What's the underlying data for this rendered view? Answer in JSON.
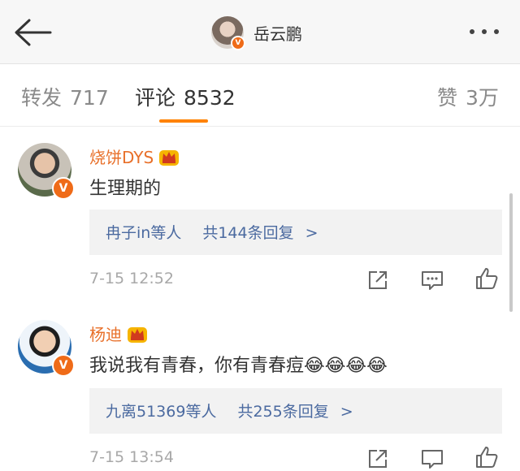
{
  "header": {
    "title": "岳云鹏",
    "verified_badge": "V"
  },
  "tabs": [
    {
      "label": "转发",
      "count": "717",
      "active": false
    },
    {
      "label": "评论",
      "count": "8532",
      "active": true
    },
    {
      "label": "赞",
      "count": "3万",
      "active": false
    }
  ],
  "comments": [
    {
      "user": "烧饼DYS",
      "verified_badge": "V",
      "text": "生理期的",
      "replies_by": "冉子in等人",
      "replies_count": "共144条回复",
      "chevron": ">",
      "time": "7-15 12:52"
    },
    {
      "user": "杨迪",
      "verified_badge": "V",
      "text": "我说我有青春，你有青春痘",
      "emoji": "😂😂😂😂",
      "replies_by": "九离51369等人",
      "replies_count": "共255条回复",
      "chevron": ">",
      "time": "7-15 13:54"
    }
  ],
  "colors": {
    "accent": "#ff8200",
    "username": "#e8702a",
    "link": "#4b6aa0",
    "verified": "#ef6b18"
  },
  "icons": [
    "back-arrow-icon",
    "more-dots-icon",
    "crown-badge-icon",
    "share-icon",
    "comment-icon",
    "like-icon"
  ]
}
